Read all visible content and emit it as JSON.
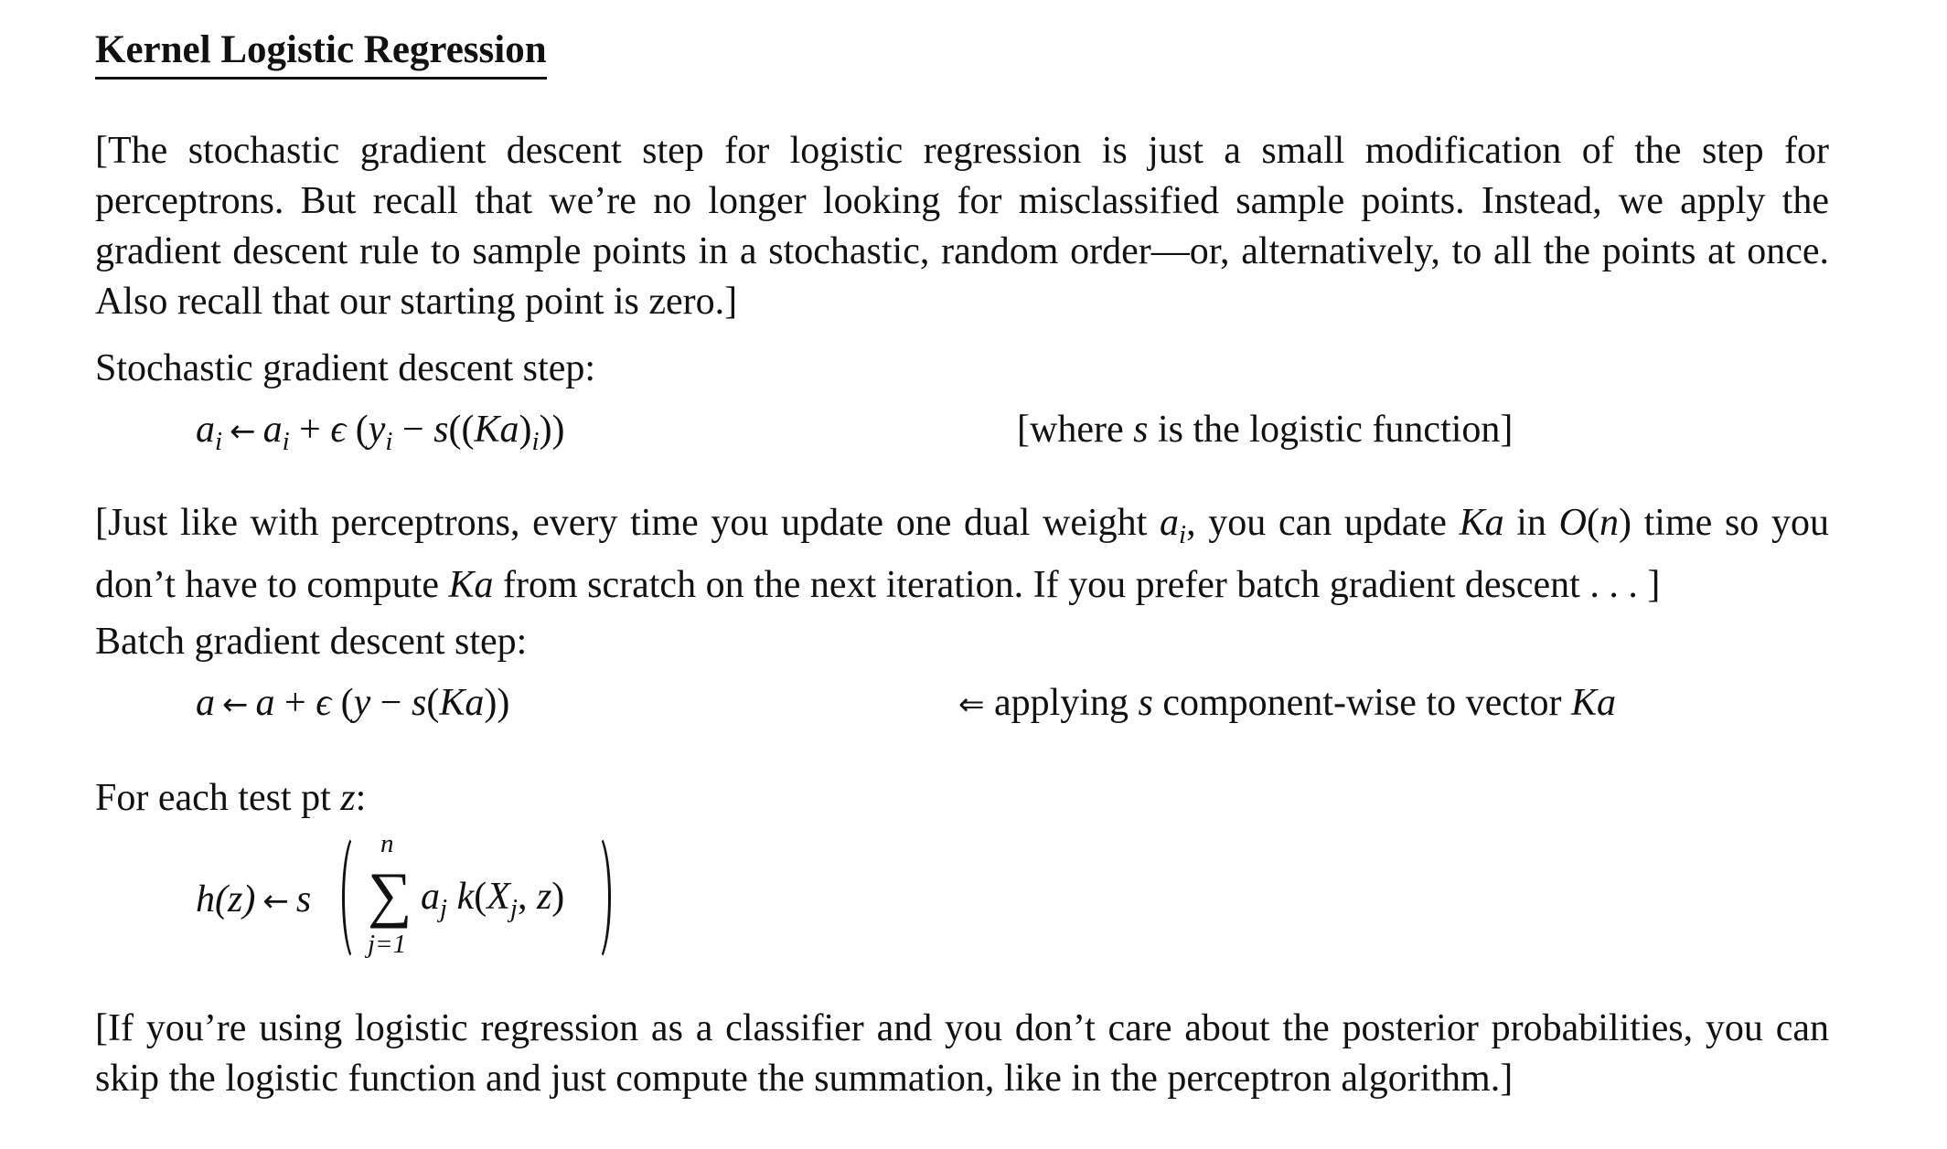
{
  "section": {
    "title": "Kernel Logistic Regression"
  },
  "intro": {
    "text": "[The stochastic gradient descent step for logistic regression is just a small modification of the step for perceptrons. But recall that we’re no longer looking for misclassified sample points. Instead, we apply the gradient descent rule to sample points in a stochastic, random order—or, alternatively, to all the points at once. Also recall that our starting point is zero.]"
  },
  "sgd": {
    "label": "Stochastic gradient descent step:",
    "equation": {
      "lhs": "a",
      "lhs_sub": "i",
      "arrow": "←",
      "rhs_a": "a",
      "rhs_a_sub": "i",
      "plus": " + ",
      "eps": "ϵ",
      "open": " (",
      "y": "y",
      "y_sub": "i",
      "minus": " − ",
      "s": "s",
      "inner_open": "((",
      "Ka": "Ka",
      "inner_close": ")",
      "inner_sub": "i",
      "close": "))"
    },
    "note_prefix": "[where ",
    "note_var": "s",
    "note_suffix": " is the logistic function]"
  },
  "dual": {
    "part1": "[Just like with perceptrons, every time you update one dual weight ",
    "var_a": "a",
    "var_a_sub": "i",
    "part2": ", you can update ",
    "var_Ka": "Ka",
    "part3": " in ",
    "var_O": "O",
    "part4": "(",
    "var_n": "n",
    "part5": ") time so you don’t have to compute ",
    "var_Ka2": "Ka",
    "part6": " from scratch on the next iteration. If you prefer batch gradient descent . . . ]"
  },
  "batch": {
    "label": "Batch gradient descent step:",
    "equation": {
      "lhs": "a",
      "arrow": "←",
      "rhs": "a",
      "plus": " + ",
      "eps": "ϵ",
      "open": " (",
      "y": "y",
      "minus": " − ",
      "s": "s",
      "s_open": "(",
      "Ka": "Ka",
      "close": "))"
    },
    "note_arrow": "⇐",
    "note_prefix": " applying ",
    "note_var": "s",
    "note_mid": " component-wise to vector ",
    "note_Ka": "Ka"
  },
  "test": {
    "label_prefix": "For each test pt ",
    "label_var": "z",
    "label_suffix": ":",
    "equation": {
      "h": "h",
      "hz": "(z)",
      "arrow": "←",
      "s": "s",
      "sigma": "∑",
      "upper": "n",
      "lower": "j=1",
      "term_a": "a",
      "term_a_sub": "j",
      "term_k": " k",
      "term_open": "(",
      "term_X": "X",
      "term_X_sub": "j",
      "term_comma": ", ",
      "term_z": "z",
      "term_close": ")"
    }
  },
  "classifier": {
    "text": "[If you’re using logistic regression as a classifier and you don’t care about the posterior probabilities, you can skip the logistic function and just compute the summation, like in the perceptron algorithm.]"
  }
}
